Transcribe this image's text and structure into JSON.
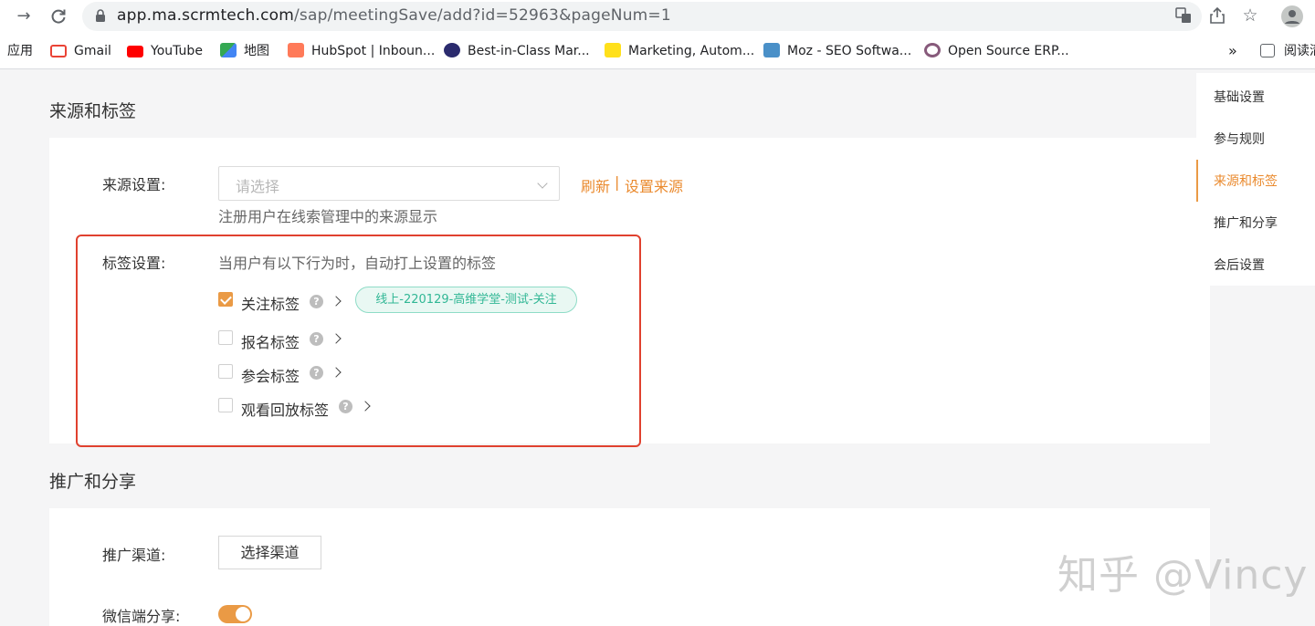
{
  "browser": {
    "url_host": "app.ma.scrmtech.com",
    "url_path": "/sap/meetingSave/add?id=52963&pageNum=1"
  },
  "bookmarks": {
    "apps_label": "应用",
    "items": [
      {
        "label": "Gmail",
        "icon": "gmail-icon",
        "color": "#ea4335"
      },
      {
        "label": "YouTube",
        "icon": "youtube-icon",
        "color": "#ff0000"
      },
      {
        "label": "地图",
        "icon": "maps-icon",
        "color": "#34a853"
      },
      {
        "label": "HubSpot | Inboun...",
        "icon": "hubspot-icon",
        "color": "#ff7a59"
      },
      {
        "label": "Best-in-Class Mar...",
        "icon": "marketo-icon",
        "color": "#2b2b6e"
      },
      {
        "label": "Marketing, Autom...",
        "icon": "mailchimp-icon",
        "color": "#ffe01b"
      },
      {
        "label": "Moz - SEO Softwa...",
        "icon": "moz-icon",
        "color": "#4a90c8"
      },
      {
        "label": "Open Source ERP...",
        "icon": "odoo-icon",
        "color": "#875a7b"
      }
    ],
    "overflow": "»",
    "reading_list": "阅读清"
  },
  "source_section": {
    "title": "来源和标签",
    "source_label": "来源设置:",
    "select_placeholder": "请选择",
    "refresh_link": "刷新",
    "separator": "|",
    "set_source_link": "设置来源",
    "source_hint": "注册用户在线索管理中的来源显示",
    "tag_label": "标签设置:",
    "tag_hint": "当用户有以下行为时，自动打上设置的标签",
    "options": [
      {
        "label": "关注标签",
        "checked": true
      },
      {
        "label": "报名标签",
        "checked": false
      },
      {
        "label": "参会标签",
        "checked": false
      },
      {
        "label": "观看回放标签",
        "checked": false
      }
    ],
    "follow_tag_chip": "线上-220129-高维学堂-测试-关注"
  },
  "promo_section": {
    "title": "推广和分享",
    "channel_label": "推广渠道:",
    "channel_button": "选择渠道",
    "wechat_label": "微信端分享:",
    "wechat_enabled": true
  },
  "anchor_nav": {
    "items": [
      {
        "label": "基础设置",
        "active": false
      },
      {
        "label": "参与规则",
        "active": false
      },
      {
        "label": "来源和标签",
        "active": true
      },
      {
        "label": "推广和分享",
        "active": false
      },
      {
        "label": "会后设置",
        "active": false
      }
    ]
  },
  "watermark": "知乎 @Vincy",
  "colors": {
    "accent": "#ea8a2e",
    "tag_green": "#31b795",
    "highlight_red": "#e0412f"
  }
}
